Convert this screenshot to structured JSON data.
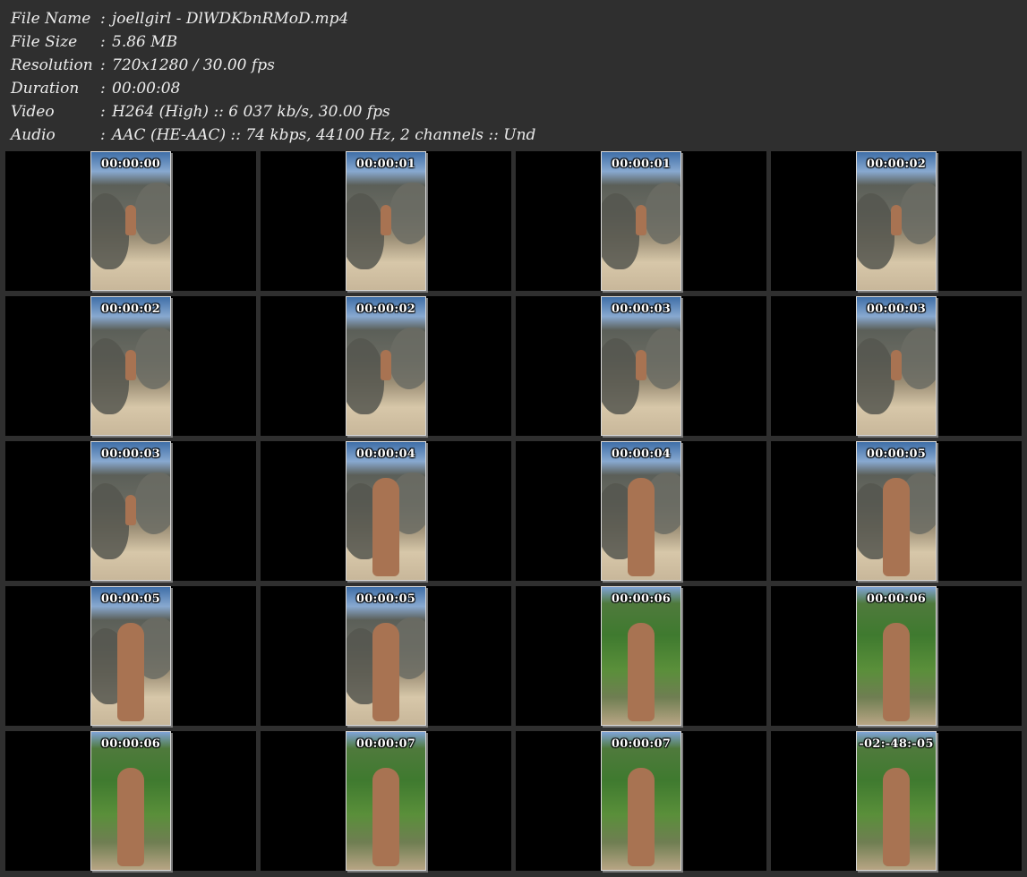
{
  "info": {
    "rows": [
      {
        "label": "File Name",
        "value": "joellgirl - DlWDKbnRMoD.mp4"
      },
      {
        "label": "File Size",
        "value": "5.86 MB"
      },
      {
        "label": "Resolution",
        "value": "720x1280 / 30.00 fps"
      },
      {
        "label": "Duration",
        "value": "00:00:08"
      },
      {
        "label": "Video",
        "value": "H264 (High) :: 6 037 kb/s, 30.00 fps"
      },
      {
        "label": "Audio",
        "value": "AAC (HE-AAC) :: 74 kbps, 44100 Hz, 2 channels :: Und"
      }
    ],
    "separator": ":"
  },
  "thumbnails": [
    {
      "time": "00:00:00"
    },
    {
      "time": "00:00:01"
    },
    {
      "time": "00:00:01"
    },
    {
      "time": "00:00:02"
    },
    {
      "time": "00:00:02"
    },
    {
      "time": "00:00:02"
    },
    {
      "time": "00:00:03"
    },
    {
      "time": "00:00:03"
    },
    {
      "time": "00:00:03"
    },
    {
      "time": "00:00:04"
    },
    {
      "time": "00:00:04"
    },
    {
      "time": "00:00:05"
    },
    {
      "time": "00:00:05"
    },
    {
      "time": "00:00:05"
    },
    {
      "time": "00:00:06"
    },
    {
      "time": "00:00:06"
    },
    {
      "time": "00:00:06"
    },
    {
      "time": "00:00:07"
    },
    {
      "time": "00:00:07"
    },
    {
      "time": "-02:-48:-05"
    }
  ]
}
